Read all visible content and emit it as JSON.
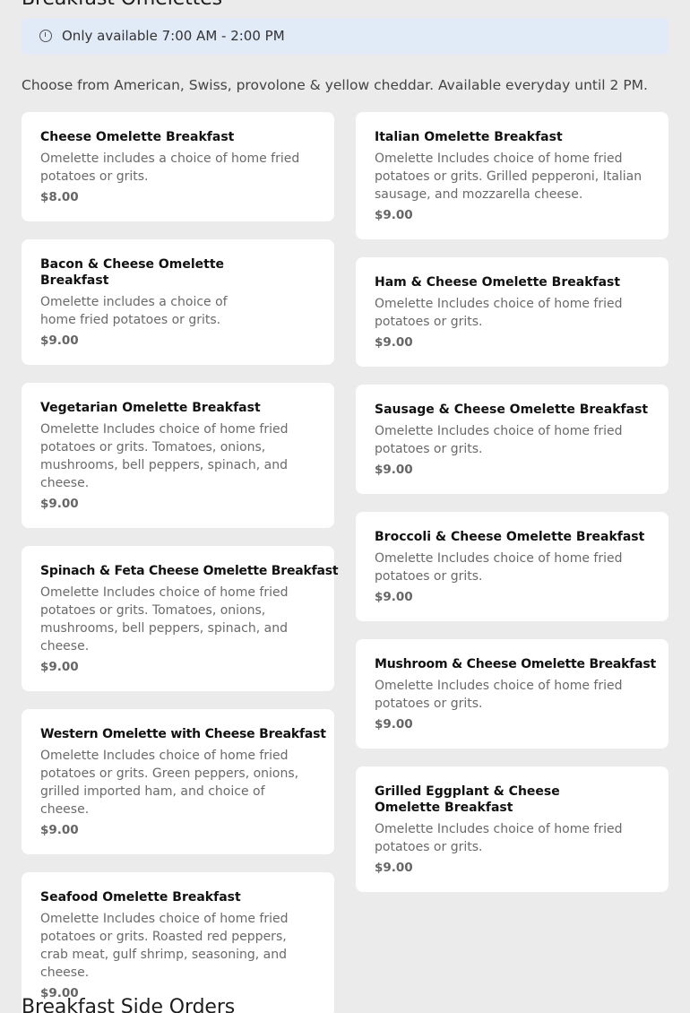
{
  "section": {
    "title": "Breakfast Omelettes",
    "availability": "Only available 7:00 AM - 2:00 PM",
    "description": "Choose from American, Swiss, provolone & yellow cheddar. Available everyday until 2 PM.",
    "icons": {
      "availability": "clock-icon"
    }
  },
  "left_items": [
    {
      "name": "Cheese Omelette Breakfast",
      "description": "Omelette includes a choice of home fried potatoes or grits.",
      "price": "$8.00"
    },
    {
      "name": "Bacon & Cheese Omelette Breakfast",
      "description": "Omelette includes a choice of home fried potatoes or grits.",
      "price": "$9.00"
    },
    {
      "name": "Vegetarian Omelette Breakfast",
      "description": "Omelette Includes choice of home fried potatoes or grits. Tomatoes, onions, mushrooms, bell peppers, spinach, and cheese.",
      "price": "$9.00"
    },
    {
      "name": "Spinach & Feta Cheese Omelette Breakfast",
      "description": "Omelette Includes choice of home fried potatoes or grits. Tomatoes, onions, mushrooms, bell peppers, spinach, and cheese.",
      "price": "$9.00"
    },
    {
      "name": "Western Omelette with Cheese Breakfast",
      "description": "Omelette Includes choice of home fried potatoes or grits. Green peppers, onions, grilled imported ham, and choice of cheese.",
      "price": "$9.00"
    },
    {
      "name": "Seafood Omelette Breakfast",
      "description": "Omelette Includes choice of home fried potatoes or grits. Roasted red peppers, crab meat, gulf shrimp, seasoning, and cheese.",
      "price": "$9.00"
    }
  ],
  "right_items": [
    {
      "name": "Italian Omelette Breakfast",
      "description": "Omelette Includes choice of home fried potatoes or grits. Grilled pepperoni, Italian sausage, and mozzarella cheese.",
      "price": "$9.00"
    },
    {
      "name": "Ham & Cheese Omelette Breakfast",
      "description": "Omelette Includes choice of home fried potatoes or grits.",
      "price": "$9.00"
    },
    {
      "name": "Sausage & Cheese Omelette Breakfast",
      "description": "Omelette Includes choice of home fried potatoes or grits.",
      "price": "$9.00"
    },
    {
      "name": "Broccoli & Cheese Omelette Breakfast",
      "description": "Omelette Includes choice of home fried potatoes or grits.",
      "price": "$9.00"
    },
    {
      "name": "Mushroom & Cheese Omelette Breakfast",
      "description": "Omelette Includes choice of home fried potatoes or grits.",
      "price": "$9.00"
    },
    {
      "name": "Grilled Eggplant & Cheese Omelette Breakfast",
      "description": "Omelette Includes choice of home fried potatoes or grits.",
      "price": "$9.00"
    }
  ],
  "next_section": {
    "title": "Breakfast Side Orders"
  }
}
